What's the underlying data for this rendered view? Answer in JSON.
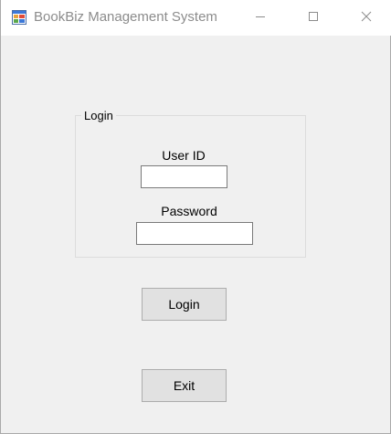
{
  "window": {
    "title": "BookBiz Management System",
    "app_icon": "windows-form-icon",
    "controls": {
      "minimize_icon": "minimize-icon",
      "maximize_icon": "maximize-icon",
      "close_icon": "close-icon"
    }
  },
  "login_group": {
    "title": "Login",
    "user_id_label": "User ID",
    "user_id_value": "",
    "password_label": "Password",
    "password_value": ""
  },
  "buttons": {
    "login_label": "Login",
    "exit_label": "Exit"
  },
  "colors": {
    "form_background": "#f0f0f0",
    "titlebar_background": "#ffffff",
    "title_text": "#8c8c8c",
    "button_face": "#e1e1e1",
    "button_border": "#adadad"
  }
}
